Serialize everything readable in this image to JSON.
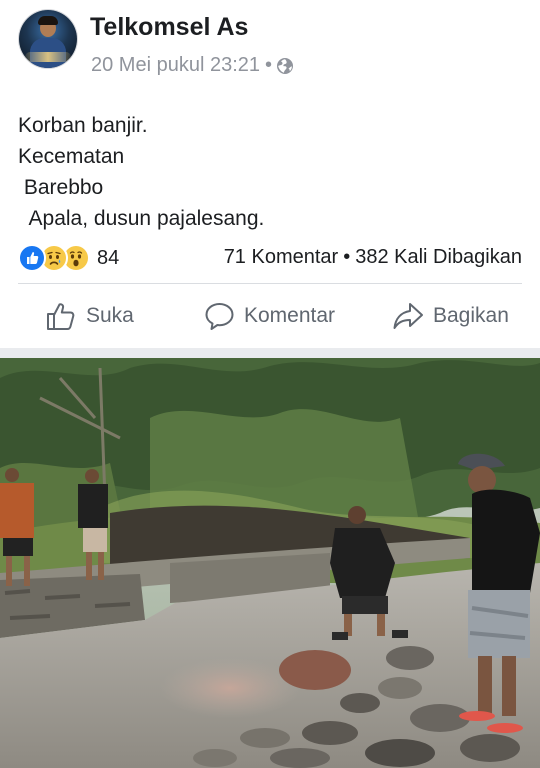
{
  "post": {
    "author_name": "Telkomsel As",
    "timestamp": "20 Mei pukul 23:21",
    "separator": "•",
    "privacy_icon": "globe-icon",
    "text_lines": [
      "Korban banjir.",
      "Kecematan",
      " Barebbo",
      "  Apala, dusun pajalesang."
    ]
  },
  "stats": {
    "reactions_icons": [
      "like-icon",
      "sad-icon",
      "wow-icon"
    ],
    "reactions_count": "84",
    "comments": "71 Komentar",
    "separator": "•",
    "shares": "382 Kali Dibagikan"
  },
  "actions": {
    "like_label": "Suka",
    "comment_label": "Komentar",
    "share_label": "Bagikan"
  },
  "colors": {
    "like_blue": "#1877f2",
    "reaction_yellow": "#f7c948",
    "meta_gray": "#90949c",
    "action_gray": "#606770",
    "divider": "#dadde1",
    "separator_band": "#e9ebee"
  }
}
